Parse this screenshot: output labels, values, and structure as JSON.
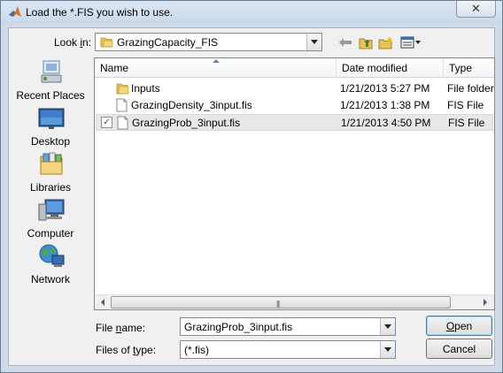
{
  "window": {
    "title": "Load the *.FIS you wish to use.",
    "close_glyph": "✕",
    "app_icon": "matlab-icon"
  },
  "lookin": {
    "label": "Look in:",
    "value": "GrazingCapacity_FIS"
  },
  "toolbar": {
    "icons": [
      "back-arrow-icon",
      "up-folder-icon",
      "new-folder-icon",
      "view-menu-icon"
    ]
  },
  "places": [
    {
      "label": "Recent Places",
      "icon": "recent-places-icon"
    },
    {
      "label": "Desktop",
      "icon": "desktop-icon"
    },
    {
      "label": "Libraries",
      "icon": "libraries-icon"
    },
    {
      "label": "Computer",
      "icon": "computer-icon"
    },
    {
      "label": "Network",
      "icon": "network-icon"
    }
  ],
  "file_list": {
    "columns": [
      "Name",
      "Date modified",
      "Type"
    ],
    "rows": [
      {
        "name": "Inputs",
        "date": "1/21/2013 5:27 PM",
        "type": "File folder",
        "icon": "folder-icon",
        "selected": false
      },
      {
        "name": "GrazingDensity_3input.fis",
        "date": "1/21/2013 1:38 PM",
        "type": "FIS File",
        "icon": "file-icon",
        "selected": false
      },
      {
        "name": "GrazingProb_3input.fis",
        "date": "1/21/2013 4:50 PM",
        "type": "FIS File",
        "icon": "file-icon",
        "selected": true
      }
    ],
    "scroll_grip": "|||"
  },
  "file_name": {
    "label": "File name:",
    "value": "GrazingProb_3input.fis"
  },
  "file_type": {
    "label": "Files of type:",
    "value": "(*.fis)"
  },
  "buttons": {
    "open": "Open",
    "cancel": "Cancel"
  },
  "colors": {
    "title_bar": "#c9d8ea",
    "folder": "#e8c35a",
    "selection": "#e8e8e8"
  }
}
